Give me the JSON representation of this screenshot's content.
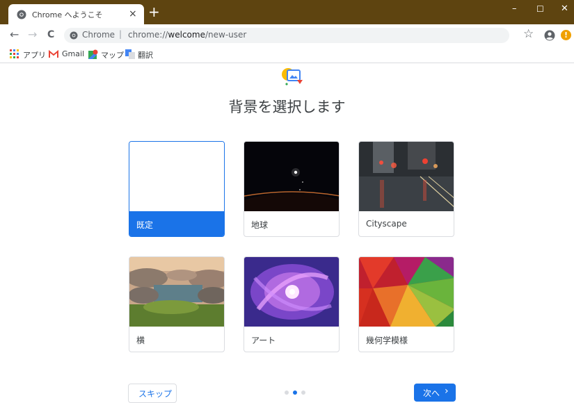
{
  "window": {
    "tab_title": "Chrome へようこそ",
    "tab_close": "×",
    "new_tab": "+",
    "minimize": "–",
    "maximize": "☐",
    "close": "✕"
  },
  "toolbar": {
    "back": "←",
    "forward": "→",
    "reload": "C",
    "site_label": "Chrome",
    "separator": "|",
    "url_prefix": "chrome://",
    "url_host": "welcome",
    "url_path": "/new-user",
    "star": "☆",
    "alert": "!"
  },
  "bookmarks": [
    {
      "label": "アプリ",
      "icon": "apps-grid-icon"
    },
    {
      "label": "Gmail",
      "icon": "gmail-icon"
    },
    {
      "label": "マップ",
      "icon": "maps-icon"
    },
    {
      "label": "翻訳",
      "icon": "translate-icon"
    }
  ],
  "page": {
    "title": "背景を選択します",
    "skip_label": "スキップ",
    "next_label": "次へ",
    "next_chevron": "›",
    "step_current": 2,
    "step_total": 3
  },
  "backgrounds": [
    {
      "label": "既定",
      "selected": true
    },
    {
      "label": "地球",
      "selected": false
    },
    {
      "label": "Cityscape",
      "selected": false
    },
    {
      "label": "横",
      "selected": false
    },
    {
      "label": "アート",
      "selected": false
    },
    {
      "label": "幾何学模様",
      "selected": false
    }
  ],
  "colors": {
    "titlebar": "#5e4410",
    "accent": "#1a73e8",
    "alert": "#f0a000"
  }
}
